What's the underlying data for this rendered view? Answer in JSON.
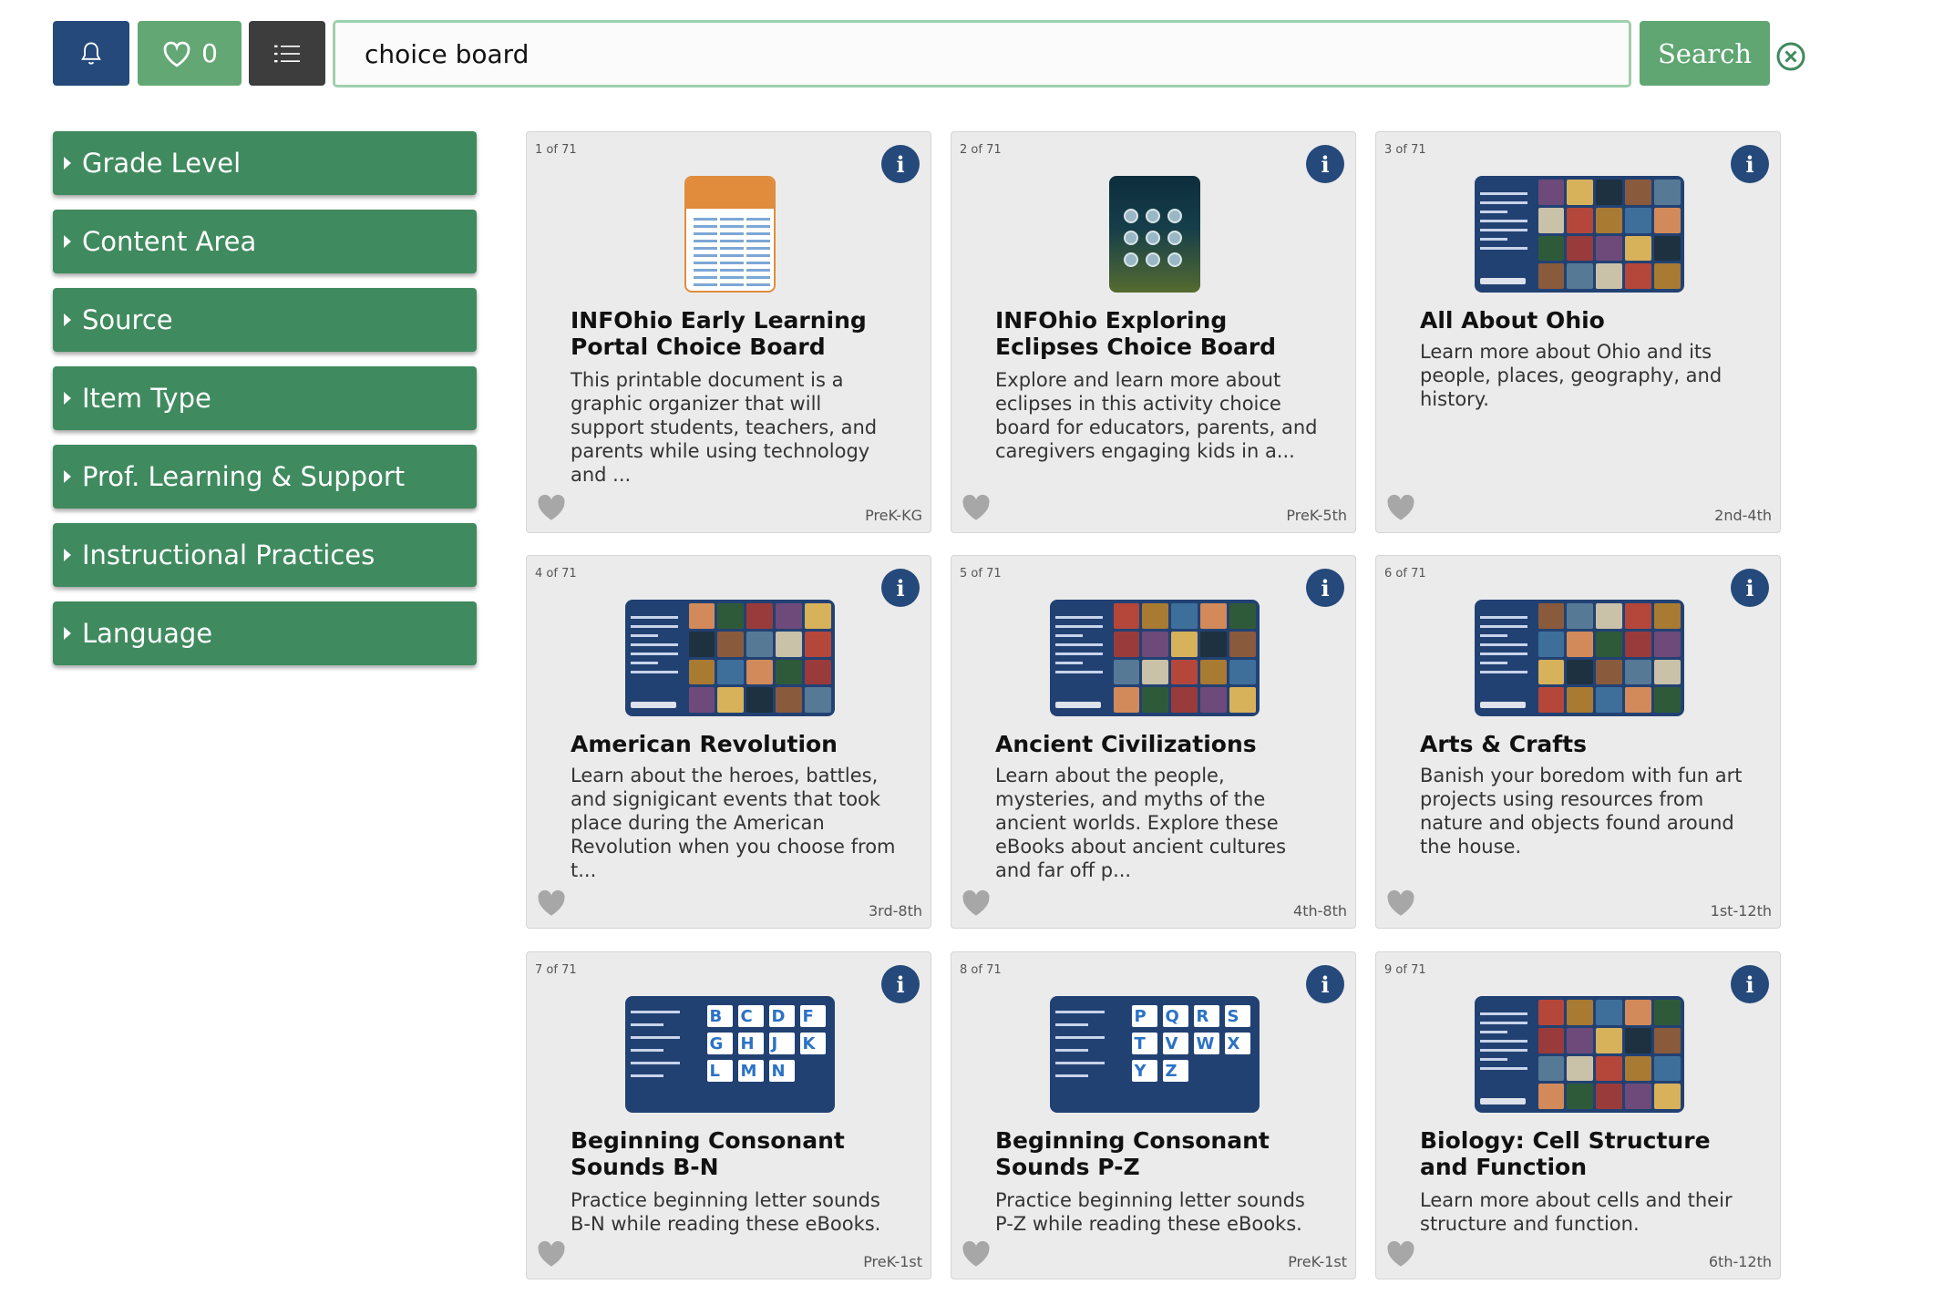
{
  "toolbar": {
    "favorites_count": "0",
    "search_value": "choice board",
    "search_label": "Search",
    "colors": {
      "bell": "#25497a",
      "favorites": "#63a874",
      "list": "#3d3d3d",
      "search": "#5fa672"
    }
  },
  "sidebar": {
    "facets": [
      {
        "label": "Grade Level"
      },
      {
        "label": "Content Area"
      },
      {
        "label": "Source"
      },
      {
        "label": "Item Type"
      },
      {
        "label": "Prof. Learning & Support"
      },
      {
        "label": "Instructional Practices"
      },
      {
        "label": "Language"
      }
    ]
  },
  "results": [
    {
      "count": "1 of 71",
      "title": "INFOhio Early Learning Portal Choice Board",
      "desc": "This printable document is a graphic organizer that will support students, teachers, and parents while using technology and ...",
      "grade": "PreK-KG",
      "thumb": "doc",
      "favorited": false
    },
    {
      "count": "2 of 71",
      "title": "INFOhio Exploring Eclipses Choice Board",
      "desc": "Explore and learn more about eclipses in this activity choice board for educators, parents, and caregivers engaging kids in a...",
      "grade": "PreK-5th",
      "thumb": "eclipse",
      "favorited": false
    },
    {
      "count": "3 of 71",
      "title": "All About Ohio",
      "desc": "Learn more about Ohio and its people, places, geography, and history.",
      "grade": "2nd-4th",
      "thumb": "collage",
      "favorited": false
    },
    {
      "count": "4 of 71",
      "title": "American Revolution",
      "desc": "Learn about the heroes, battles, and signigicant events that took place during the American Revolution when you choose from t...",
      "grade": "3rd-8th",
      "thumb": "collage",
      "favorited": false
    },
    {
      "count": "5 of 71",
      "title": "Ancient Civilizations",
      "desc": "Learn about the people, mysteries, and myths of the ancient worlds. Explore these eBooks about ancient cultures and far off p...",
      "grade": "4th-8th",
      "thumb": "collage",
      "favorited": false
    },
    {
      "count": "6 of 71",
      "title": "Arts & Crafts",
      "desc": "Banish your boredom with fun art projects using resources from nature and objects found around the house.",
      "grade": "1st-12th",
      "thumb": "collage",
      "favorited": false
    },
    {
      "count": "7 of 71",
      "title": "Beginning Consonant Sounds B-N",
      "desc": "Practice beginning letter sounds B-N while reading these eBooks.",
      "grade": "PreK-1st",
      "thumb": "letters",
      "letters": [
        "B",
        "C",
        "D",
        "F",
        "G",
        "H",
        "J",
        "K",
        "L",
        "M",
        "N"
      ],
      "favorited": false
    },
    {
      "count": "8 of 71",
      "title": "Beginning Consonant Sounds P-Z",
      "desc": "Practice beginning letter sounds P-Z while reading these eBooks.",
      "grade": "PreK-1st",
      "thumb": "letters",
      "letters": [
        "P",
        "Q",
        "R",
        "S",
        "T",
        "V",
        "W",
        "X",
        "Y",
        "Z"
      ],
      "favorited": false
    },
    {
      "count": "9 of 71",
      "title": "Biology: Cell Structure and Function",
      "desc": "Learn more about cells and their structure and function.",
      "grade": "6th-12th",
      "thumb": "collage",
      "favorited": false
    }
  ]
}
